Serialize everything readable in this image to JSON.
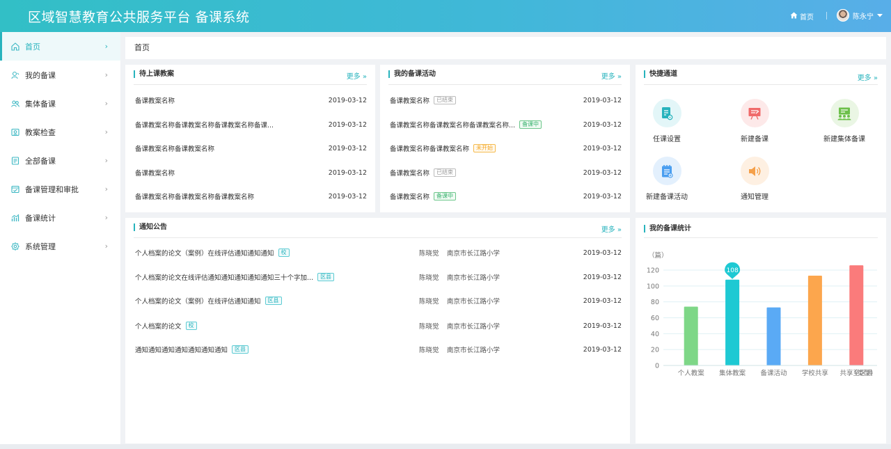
{
  "header": {
    "title": "区域智慧教育公共服务平台 备课系统",
    "home_label": "首页",
    "user_name": "陈永宁"
  },
  "sidebar": {
    "items": [
      {
        "label": "首页",
        "icon": "home-icon"
      },
      {
        "label": "我的备课",
        "icon": "user-edit-icon"
      },
      {
        "label": "集体备课",
        "icon": "group-icon"
      },
      {
        "label": "教案检查",
        "icon": "inspect-icon"
      },
      {
        "label": "全部备课",
        "icon": "document-icon"
      },
      {
        "label": "备课管理和审批",
        "icon": "approve-icon"
      },
      {
        "label": "备课统计",
        "icon": "stats-icon"
      },
      {
        "label": "系统管理",
        "icon": "settings-icon"
      }
    ]
  },
  "breadcrumb": "首页",
  "pending": {
    "title": "待上课教案",
    "more": "更多",
    "rows": [
      {
        "name": "备课教案名称",
        "date": "2019-03-12"
      },
      {
        "name": "备课教案名称备课教案名称备课教案名称备课...",
        "date": "2019-03-12"
      },
      {
        "name": "备课教案名称备课教案名称",
        "date": "2019-03-12"
      },
      {
        "name": "备课教案名称",
        "date": "2019-03-12"
      },
      {
        "name": "备课教案名称备课教案名称备课教案名称",
        "date": "2019-03-12"
      }
    ]
  },
  "activities": {
    "title": "我的备课活动",
    "more": "更多",
    "rows": [
      {
        "name": "备课教案名称",
        "status": "已结束",
        "status_color": "#999999",
        "date": "2019-03-12"
      },
      {
        "name": "备课教案名称备课教案名称备课教案名称...",
        "status": "备课中",
        "status_color": "#3cb371",
        "date": "2019-03-12"
      },
      {
        "name": "备课教案名称备课教案名称",
        "status": "未开始",
        "status_color": "#f5a623",
        "date": "2019-03-12"
      },
      {
        "name": "备课教案名称",
        "status": "已结束",
        "status_color": "#999999",
        "date": "2019-03-12"
      },
      {
        "name": "备课教案名称",
        "status": "备课中",
        "status_color": "#3cb371",
        "date": "2019-03-12"
      }
    ]
  },
  "shortcuts": {
    "title": "快捷通道",
    "more": "更多",
    "items": [
      {
        "label": "任课设置",
        "icon": "course-settings-icon",
        "color": "#27b3bd",
        "bg": "#e3f6f8"
      },
      {
        "label": "新建备课",
        "icon": "new-lesson-icon",
        "color": "#f06a6a",
        "bg": "#fde9e9"
      },
      {
        "label": "新建集体备课",
        "icon": "new-group-lesson-icon",
        "color": "#6cc04a",
        "bg": "#eaf6e4"
      },
      {
        "label": "新建备课活动",
        "icon": "new-activity-icon",
        "color": "#4a9ef0",
        "bg": "#e3f0fd"
      },
      {
        "label": "通知管理",
        "icon": "speaker-icon",
        "color": "#f5a04a",
        "bg": "#fef0e2"
      }
    ]
  },
  "notices": {
    "title": "通知公告",
    "more": "更多",
    "rows": [
      {
        "title": "个人档案的论文（案例）在线评估通知通知通知",
        "scope": "校",
        "author": "陈晓觉",
        "school": "南京市长江路小学",
        "date": "2019-03-12"
      },
      {
        "title": "个人档案的论文在线评估通知通知通知通知通知三十个字加...",
        "scope": "区县",
        "author": "陈晓觉",
        "school": "南京市长江路小学",
        "date": "2019-03-12"
      },
      {
        "title": "个人档案的论文（案例）在线评估通知通知",
        "scope": "区县",
        "author": "陈晓觉",
        "school": "南京市长江路小学",
        "date": "2019-03-12"
      },
      {
        "title": "个人档案的论文",
        "scope": "校",
        "author": "陈晓觉",
        "school": "南京市长江路小学",
        "date": "2019-03-12"
      },
      {
        "title": "通知通知通知通知通知通知通知",
        "scope": "区县",
        "author": "陈晓觉",
        "school": "南京市长江路小学",
        "date": "2019-03-12"
      }
    ]
  },
  "stats": {
    "title": "我的备课统计"
  },
  "chart_data": {
    "type": "bar",
    "title": "",
    "ylabel": "（篇）",
    "xlabel": "（类型）",
    "ylim": [
      0,
      120
    ],
    "yticks": [
      0,
      20,
      40,
      60,
      80,
      100,
      120
    ],
    "categories": [
      "个人教案",
      "集体教案",
      "备课活动",
      "学校共享",
      "共享至区县"
    ],
    "values": [
      74,
      108,
      73,
      113,
      126
    ],
    "colors": [
      "#7ed787",
      "#1ec9d3",
      "#5aaaf5",
      "#fca64d",
      "#fa7b7b"
    ],
    "highlight_index": 1,
    "highlight_label": "108",
    "grid": true
  }
}
